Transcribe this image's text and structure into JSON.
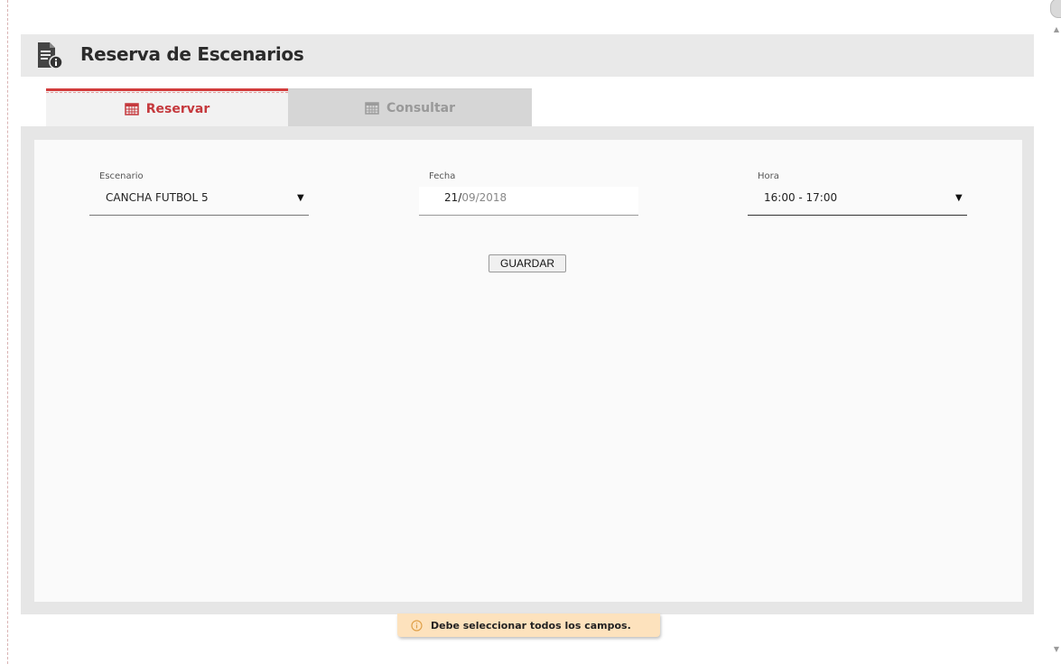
{
  "header": {
    "title": "Reserva de Escenarios",
    "icon": "document-info-icon"
  },
  "tabs": [
    {
      "label": "Reservar",
      "icon": "calendar-icon",
      "active": true
    },
    {
      "label": "Consultar",
      "icon": "calendar-icon",
      "active": false
    }
  ],
  "form": {
    "escenario": {
      "label": "Escenario",
      "value": "CANCHA FUTBOL 5"
    },
    "fecha": {
      "label": "Fecha",
      "day": "21/",
      "rest": "09/2018"
    },
    "hora": {
      "label": "Hora",
      "value": "16:00 - 17:00"
    },
    "guardar_label": "GUARDAR"
  },
  "toast": {
    "message": "Debe seleccionar todos los campos.",
    "icon": "info-circle-icon"
  },
  "colors": {
    "accent": "#d23c3c",
    "toast_bg": "#fde2bd",
    "header_bg": "#e9e9e9"
  }
}
